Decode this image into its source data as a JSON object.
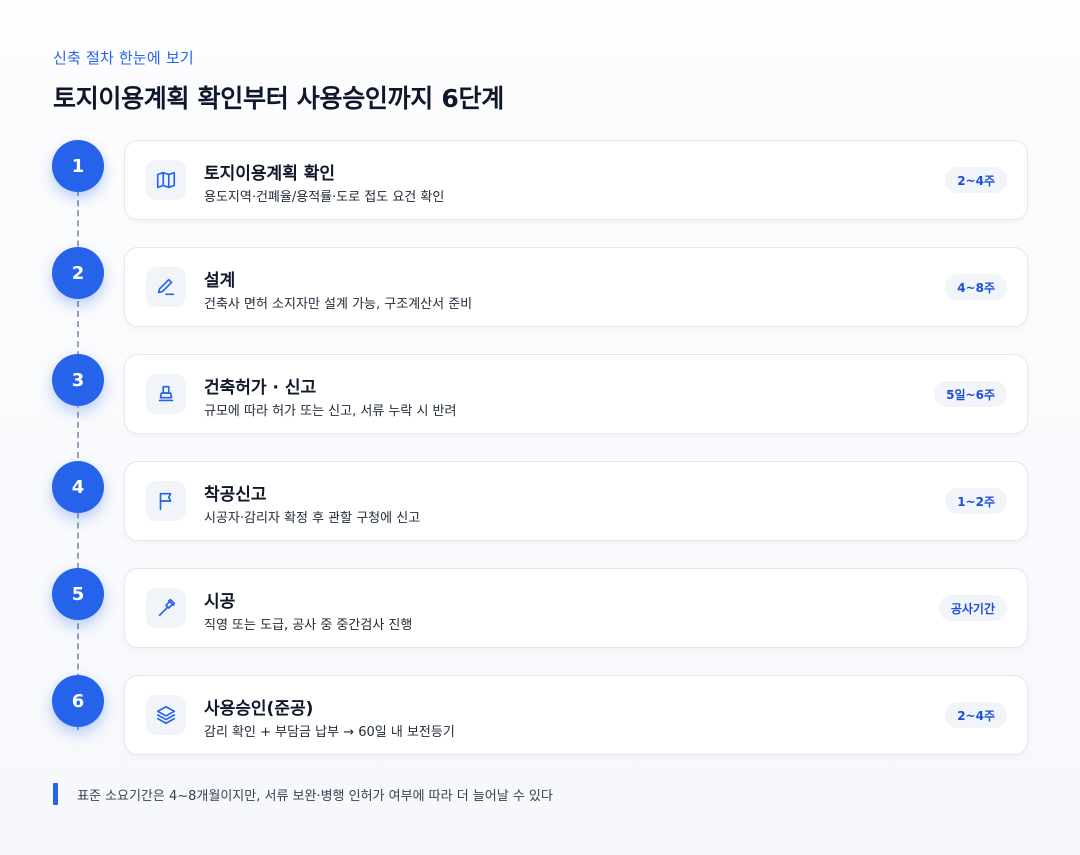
{
  "header": {
    "eyebrow": "신축 절차 한눈에 보기",
    "title": "토지이용계획 확인부터 사용승인까지 6단계"
  },
  "steps": [
    {
      "number": "1",
      "title": "토지이용계획 확인",
      "description": "용도지역·건폐율/용적률·도로 접도 요건 확인",
      "duration": "2~4주",
      "icon": "map-icon"
    },
    {
      "number": "2",
      "title": "설계",
      "description": "건축사 면허 소지자만 설계 가능, 구조계산서 준비",
      "duration": "4~8주",
      "icon": "pencil-icon"
    },
    {
      "number": "3",
      "title": "건축허가 · 신고",
      "description": "규모에 따라 허가 또는 신고, 서류 누락 시 반려",
      "duration": "5일~6주",
      "icon": "stamp-icon"
    },
    {
      "number": "4",
      "title": "착공신고",
      "description": "시공자·감리자 확정 후 관할 구청에 신고",
      "duration": "1~2주",
      "icon": "flag-icon"
    },
    {
      "number": "5",
      "title": "시공",
      "description": "직영 또는 도급, 공사 중 중간검사 진행",
      "duration": "공사기간",
      "icon": "hammer-icon"
    },
    {
      "number": "6",
      "title": "사용승인(준공)",
      "description": "감리 확인 + 부담금 납부 → 60일 내 보전등기",
      "duration": "2~4주",
      "icon": "layers-icon"
    }
  ],
  "footnote": "표준 소요기간은 4~8개월이지만, 서류 보완·병행 인허가 여부에 따라 더 늘어날 수 있다",
  "colors": {
    "accent": "#2563eb",
    "badge_bg": "#f1f5f9",
    "badge_text": "#1d4ed8"
  }
}
